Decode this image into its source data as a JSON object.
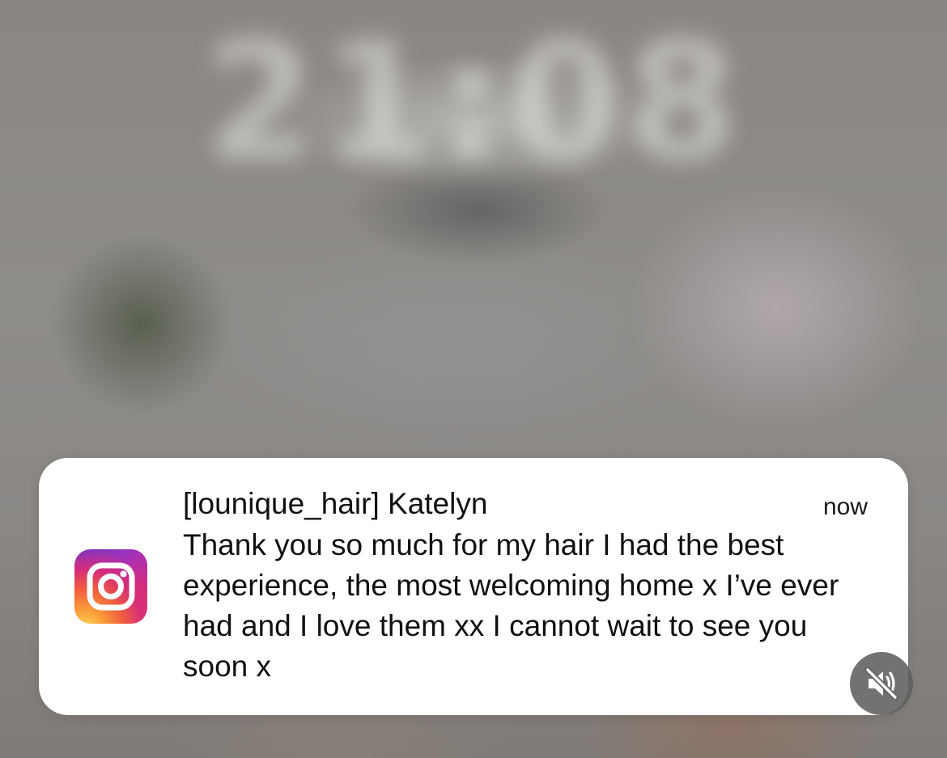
{
  "lock_screen": {
    "clock": "21:08"
  },
  "notification": {
    "app_icon": "instagram-icon",
    "title": "[lounique_hair] Katelyn",
    "time": "now",
    "message": "Thank you so much for my hair I had the best experience, the most welcoming home x I’ve ever had and I love them xx I cannot wait to see you soon x"
  },
  "overlay": {
    "mute_icon": "speaker-muted-icon"
  }
}
